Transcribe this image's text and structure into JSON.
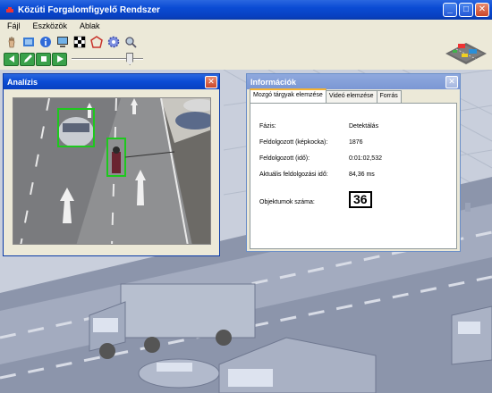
{
  "window": {
    "title": "Közúti Forgalomfigyelő Rendszer"
  },
  "menu": [
    {
      "label": "Fájl"
    },
    {
      "label": "Eszközök"
    },
    {
      "label": "Ablak"
    }
  ],
  "toolbar": {
    "row1": [
      "hand-icon",
      "film-icon",
      "info-icon",
      "monitor-icon",
      "checker-icon",
      "shape-icon",
      "gear-icon",
      "search-icon"
    ],
    "row2": [
      "prev-icon",
      "edit-icon",
      "stop-icon",
      "play-icon"
    ],
    "slider_position": 0.85
  },
  "analysis_window": {
    "title": "Analízis"
  },
  "info_window": {
    "title": "Információk",
    "tabs": [
      {
        "label": "Mozgó tárgyak elemzése",
        "active": true
      },
      {
        "label": "Videó elemzése",
        "active": false
      },
      {
        "label": "Forrás",
        "active": false
      }
    ],
    "fields": [
      {
        "label": "Fázis:",
        "value": "Detektálás"
      },
      {
        "label": "Feldolgozott (képkocka):",
        "value": "1876"
      },
      {
        "label": "Feldolgozott (idő):",
        "value": "0:01:02,532"
      },
      {
        "label": "Aktuális feldolgozási idő:",
        "value": "84,36 ms"
      }
    ],
    "object_count": {
      "label": "Objektumok száma:",
      "value": "36"
    }
  },
  "colors": {
    "titlebar": "#0a4bd4",
    "detection_box": "#1ec81e",
    "info_titlebar": "#7b97d4"
  }
}
